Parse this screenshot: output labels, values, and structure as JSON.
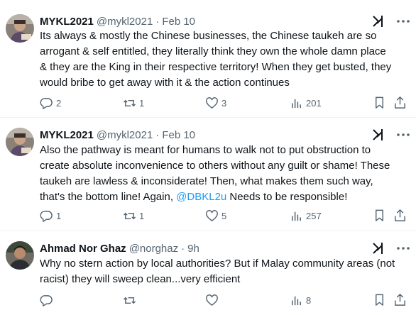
{
  "tweets": [
    {
      "name": "MYKL2021",
      "handle": "@mykl2021",
      "separator": "·",
      "date": "Feb 10",
      "lines": [
        "Its always & mostly the Chinese businesses, the Chinese taukeh are so",
        "arrogant & self entitled, they literally think they own the whole damn place",
        "& they are the King in their respective territory! When they get busted, they",
        "would bribe to get away with it & the action continues"
      ],
      "replies": "2",
      "reposts": "1",
      "likes": "3",
      "views": "201"
    },
    {
      "name": "MYKL2021",
      "handle": "@mykl2021",
      "separator": "·",
      "date": "Feb 10",
      "lines": [
        "Also the pathway is meant for humans to walk not to put obstruction to",
        "create absolute inconvenience to others without any guilt or shame!  These",
        "taukeh are lawless & inconsiderate! Then, what makes them such way,",
        "that's the bottom line!  Again, "
      ],
      "mention": "@DBKL2u",
      "last_line_tail": " Needs to be responsible!",
      "replies": "1",
      "reposts": "1",
      "likes": "5",
      "views": "257"
    },
    {
      "name": "Ahmad Nor Ghaz",
      "handle": "@norghaz",
      "separator": "·",
      "date": "9h",
      "lines": [
        "Why no stern action by local authorities? But if Malay community areas (not",
        "racist) they will sweep clean...very efficient"
      ],
      "views": "8"
    }
  ],
  "icons": {
    "reply": "reply-icon",
    "repost": "repost-icon",
    "like": "like-icon",
    "views": "views-icon",
    "bookmark": "bookmark-icon",
    "share": "share-icon",
    "grok": "grok-icon",
    "more": "more-icon"
  },
  "colors": {
    "text": "#0f1419",
    "secondary": "#536471",
    "link": "#1d9bf0",
    "divider": "#eff3f4"
  }
}
